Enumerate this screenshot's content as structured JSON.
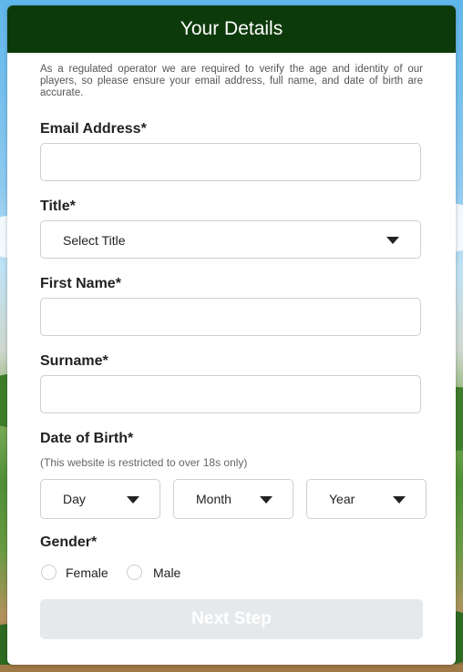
{
  "header": {
    "title": "Your Details"
  },
  "intro_text": "As a regulated operator we are required to verify the age and identity of our players, so please ensure your email address, full name, and date of birth are accurate.",
  "fields": {
    "email": {
      "label": "Email Address*",
      "value": ""
    },
    "title": {
      "label": "Title*",
      "selected": "Select Title"
    },
    "first_name": {
      "label": "First Name*",
      "value": ""
    },
    "surname": {
      "label": "Surname*",
      "value": ""
    },
    "dob": {
      "label": "Date of Birth*",
      "note": "(This website is restricted to over 18s only)",
      "day": "Day",
      "month": "Month",
      "year": "Year"
    },
    "gender": {
      "label": "Gender*",
      "options": [
        "Female",
        "Male"
      ]
    }
  },
  "next_button": "Next Step",
  "colors": {
    "header_bg": "#0d3a0a",
    "button_disabled_bg": "#e6e9eb"
  },
  "icons": [
    "chevron-down-icon"
  ]
}
